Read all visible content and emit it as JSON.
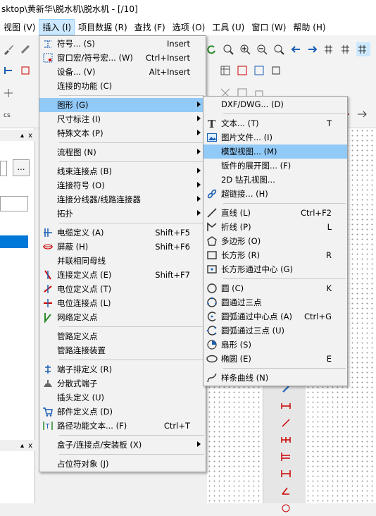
{
  "window": {
    "title": "sktop\\黄新华\\脱水机\\脱水机 - [/10]"
  },
  "menubar": [
    {
      "id": "view",
      "label": "视图 (V)"
    },
    {
      "id": "insert",
      "label": "插入 (I)"
    },
    {
      "id": "project",
      "label": "项目数据 (R)"
    },
    {
      "id": "find",
      "label": "查找 (F)"
    },
    {
      "id": "options",
      "label": "选项 (O)"
    },
    {
      "id": "tools",
      "label": "工具 (U)"
    },
    {
      "id": "window",
      "label": "窗口 (W)"
    },
    {
      "id": "help",
      "label": "帮助 (H)"
    }
  ],
  "left_panel": {
    "ellipsis": "...",
    "pin": "▴",
    "close": "x"
  },
  "insert_menu": [
    {
      "name": "symbol",
      "label": "符号... (S)",
      "shortcut": "Insert",
      "icon": "symbol-icon"
    },
    {
      "name": "window-macro",
      "label": "窗口宏/符号宏... (W)",
      "shortcut": "Ctrl+Insert",
      "icon": "window-macro-icon"
    },
    {
      "name": "device",
      "label": "设备... (V)",
      "shortcut": "Alt+Insert"
    },
    {
      "name": "connection-function",
      "label": "连接的功能 (C)",
      "shortcut": ""
    },
    {
      "sep": true
    },
    {
      "name": "graphics",
      "label": "图形 (G)",
      "submenu": true,
      "highlight": true
    },
    {
      "name": "dimension",
      "label": "尺寸标注 (I)",
      "submenu": true
    },
    {
      "name": "special-text",
      "label": "特殊文本 (P)",
      "submenu": true
    },
    {
      "sep": true
    },
    {
      "name": "flowchart",
      "label": "流程图 (N)",
      "submenu": true
    },
    {
      "sep": true
    },
    {
      "name": "harness-connection",
      "label": "线束连接点 (B)",
      "submenu": true
    },
    {
      "name": "connection-symbol",
      "label": "连接符号 (O)",
      "submenu": true
    },
    {
      "name": "connection-splitter",
      "label": "连接分线器/线路连接器",
      "submenu": true
    },
    {
      "name": "topology",
      "label": "拓扑",
      "submenu": true
    },
    {
      "sep": true
    },
    {
      "name": "cable-definition",
      "label": "电缆定义 (A)",
      "shortcut": "Shift+F5",
      "icon": "cable-icon"
    },
    {
      "name": "shield",
      "label": "屏蔽 (H)",
      "shortcut": "Shift+F6",
      "icon": "shield-icon"
    },
    {
      "name": "parallel-bus",
      "label": "并联相同母线",
      "shortcut": ""
    },
    {
      "name": "connection-definition-point",
      "label": "连接定义点 (E)",
      "shortcut": "Shift+F7",
      "icon": "connection-definition-icon"
    },
    {
      "name": "potential-definition-point",
      "label": "电位定义点 (T)",
      "shortcut": "",
      "icon": "potential-definition-icon"
    },
    {
      "name": "potential-connection-point",
      "label": "电位连接点 (L)",
      "shortcut": "",
      "icon": "potential-connection-icon"
    },
    {
      "name": "network-definition-point",
      "label": "网络定义点",
      "shortcut": "",
      "icon": "network-definition-icon"
    },
    {
      "sep": true
    },
    {
      "name": "pipe-definition-point",
      "label": "管路定义点",
      "shortcut": ""
    },
    {
      "name": "pipe-connection-device",
      "label": "管路连接装置",
      "shortcut": ""
    },
    {
      "sep": true
    },
    {
      "name": "terminal-strip-definition",
      "label": "端子排定义 (R)",
      "shortcut": "",
      "icon": "terminal-strip-icon"
    },
    {
      "name": "distributed-terminal",
      "label": "分散式端子",
      "shortcut": "",
      "icon": "distributed-terminal-icon"
    },
    {
      "name": "plug-definition",
      "label": "插头定义 (U)",
      "shortcut": ""
    },
    {
      "name": "part-definition-point",
      "label": "部件定义点 (D)",
      "shortcut": "",
      "icon": "cart-icon"
    },
    {
      "name": "path-function-text",
      "label": "路径功能文本... (F)",
      "shortcut": "Ctrl+T",
      "icon": "path-function-text-icon"
    },
    {
      "sep": true
    },
    {
      "name": "box-connection-mounting",
      "label": "盒子/连接点/安装板 (X)",
      "submenu": true
    },
    {
      "sep": true
    },
    {
      "name": "placeholder-object",
      "label": "占位符对象 (J)",
      "shortcut": ""
    }
  ],
  "graphics_submenu": [
    {
      "name": "dxf-dwg",
      "label": "DXF/DWG... (D)",
      "shortcut": ""
    },
    {
      "sep": true
    },
    {
      "name": "text",
      "label": "文本... (T)",
      "shortcut": "T",
      "icon": "text-icon"
    },
    {
      "name": "image-file",
      "label": "图片文件... (I)",
      "shortcut": "",
      "icon": "image-icon"
    },
    {
      "name": "model-view",
      "label": "模型视图... (M)",
      "shortcut": "",
      "highlight": true
    },
    {
      "name": "sheet-metal-unfold",
      "label": "钣件的展开图... (F)",
      "shortcut": ""
    },
    {
      "name": "drill-view-2d",
      "label": "2D 钻孔视图...",
      "shortcut": ""
    },
    {
      "name": "hyperlink",
      "label": "超链接... (H)",
      "shortcut": "",
      "icon": "link-icon"
    },
    {
      "sep": true
    },
    {
      "name": "line",
      "label": "直线 (L)",
      "shortcut": "Ctrl+F2",
      "icon": "line-icon"
    },
    {
      "name": "polyline",
      "label": "折线 (P)",
      "shortcut": "L",
      "icon": "polyline-icon"
    },
    {
      "name": "polygon",
      "label": "多边形 (O)",
      "shortcut": "",
      "icon": "polygon-icon"
    },
    {
      "name": "rectangle",
      "label": "长方形 (R)",
      "shortcut": "R",
      "icon": "rectangle-icon"
    },
    {
      "name": "rectangle-center",
      "label": "长方形通过中心 (G)",
      "shortcut": "",
      "icon": "rectangle-center-icon"
    },
    {
      "sep": true
    },
    {
      "name": "circle",
      "label": "圆 (C)",
      "shortcut": "K",
      "icon": "circle-icon"
    },
    {
      "name": "circle-3pt",
      "label": "圆通过三点",
      "shortcut": "",
      "icon": "circle-3pt-icon"
    },
    {
      "name": "arc-center",
      "label": "圆弧通过中心点 (A)",
      "shortcut": "Ctrl+G",
      "icon": "arc-center-icon"
    },
    {
      "name": "arc-3pt",
      "label": "圆弧通过三点 (U)",
      "shortcut": "",
      "icon": "arc-3pt-icon"
    },
    {
      "name": "sector",
      "label": "扇形 (S)",
      "shortcut": "",
      "icon": "sector-icon"
    },
    {
      "name": "ellipse",
      "label": "椭圆 (E)",
      "shortcut": "E",
      "icon": "ellipse-icon"
    },
    {
      "sep": true
    },
    {
      "name": "spline",
      "label": "样条曲线 (N)",
      "shortcut": "",
      "icon": "spline-icon"
    }
  ],
  "colors": {
    "menu_highlight": "#91c9f7",
    "menubar_active": "#cce8ff",
    "selection": "#0078d7"
  }
}
